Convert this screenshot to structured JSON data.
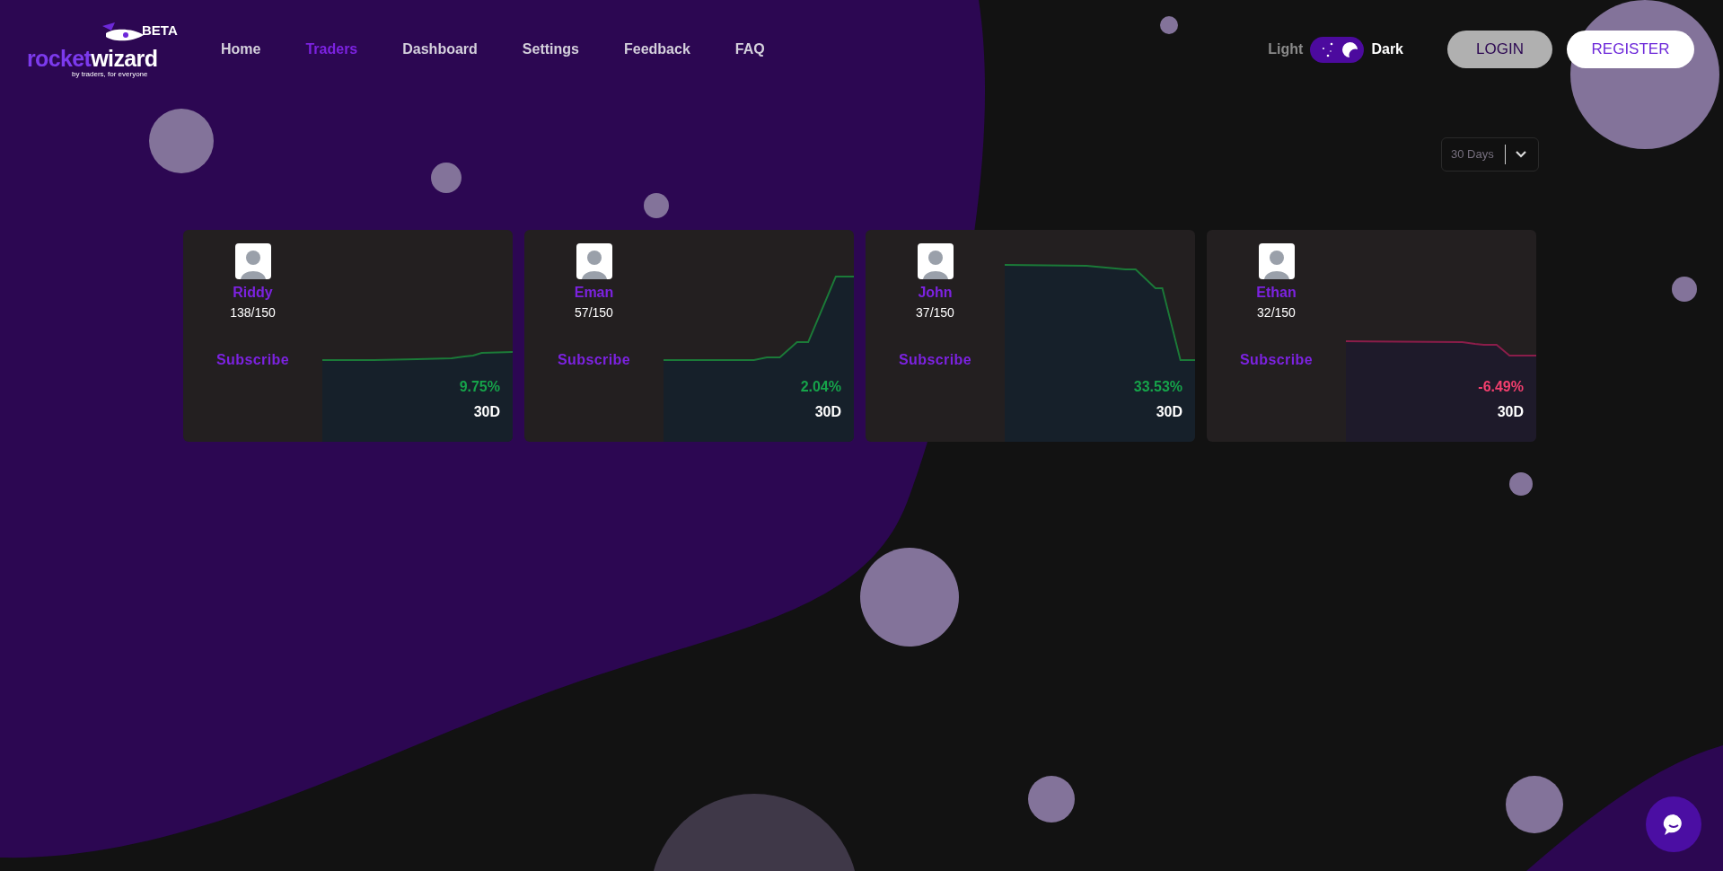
{
  "logo": {
    "word_1": "rocket",
    "word_2": "wizard",
    "tagline": "by traders, for everyone",
    "badge": "BETA"
  },
  "nav": [
    {
      "label": "Home",
      "selected": false
    },
    {
      "label": "Traders",
      "selected": true
    },
    {
      "label": "Dashboard",
      "selected": false
    },
    {
      "label": "Settings",
      "selected": false
    },
    {
      "label": "Feedback",
      "selected": false
    },
    {
      "label": "FAQ",
      "selected": false
    }
  ],
  "theme_toggle": {
    "light_label": "Light",
    "dark_label": "Dark",
    "dark": true
  },
  "buttons": {
    "login": "LOGIN",
    "register": "REGISTER"
  },
  "period_select": {
    "value": "30 Days"
  },
  "traders": [
    {
      "name": "Riddy",
      "subscribers": "138/150",
      "action": "Subscribe",
      "change": "9.75%",
      "period": "30D",
      "kind": "gain"
    },
    {
      "name": "Eman",
      "subscribers": "57/150",
      "action": "Subscribe",
      "change": "2.04%",
      "period": "30D",
      "kind": "gain"
    },
    {
      "name": "John",
      "subscribers": "37/150",
      "action": "Subscribe",
      "change": "33.53%",
      "period": "30D",
      "kind": "gain"
    },
    {
      "name": "Ethan",
      "subscribers": "32/150",
      "action": "Subscribe",
      "change": "-6.49%",
      "period": "30D",
      "kind": "loss"
    }
  ]
}
